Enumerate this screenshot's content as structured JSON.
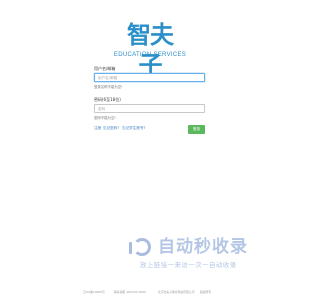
{
  "brand": {
    "logo_text": "智夫子",
    "logo_subtitle": "EDUCATION SERVICES"
  },
  "form": {
    "username_label": "用户名/邮箱",
    "username_placeholder": "用户名/邮箱",
    "username_hint": "登录名称不能为空!",
    "password_label": "密码(6至18位)",
    "password_placeholder": "密码",
    "password_hint": "密码不能为空!",
    "register_link": "注册",
    "forgot_link": "忘记密码?",
    "forgot_id_link": "忘记学生账号?",
    "submit_label": "登录"
  },
  "watermark": {
    "title": "自动秒收录",
    "subtitle": "放上链接一来访一次一自动收录"
  },
  "footer": {
    "items": [
      "京ICP备19009号",
      "联系客服 400-000-0000",
      "北京智夫子教育科技有限公司",
      "版权所有"
    ]
  },
  "colors": {
    "brand_blue": "#2b8fc9",
    "focus_blue": "#66afe9",
    "link_blue": "#3a7fc1",
    "submit_green": "#5cb85c",
    "watermark_blue": "#9bb4dd"
  },
  "icons": {
    "watermark_logo": "jr-ring-logo"
  }
}
